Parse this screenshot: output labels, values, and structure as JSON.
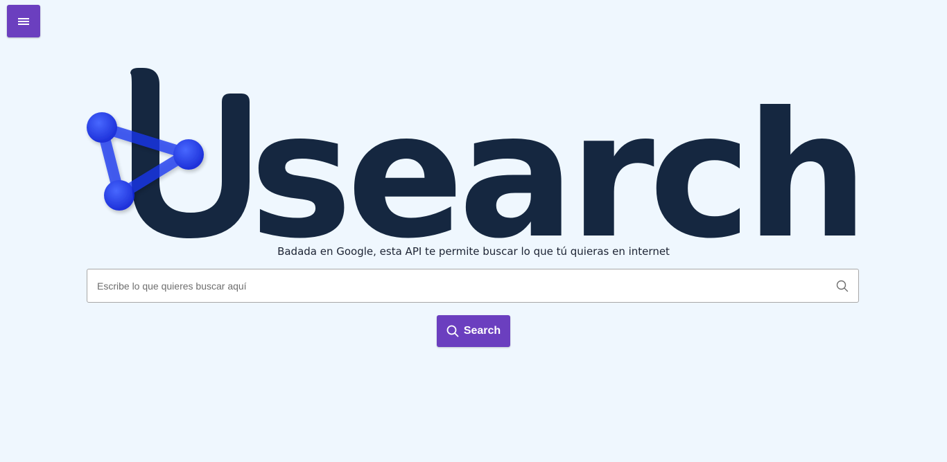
{
  "app": {
    "logo_text": "Usearch",
    "brand_color": "#6b3fbf",
    "logo_text_color": "#152740",
    "logo_mark_color": "#1a3cf0"
  },
  "menu": {
    "icon": "hamburger-menu-icon"
  },
  "hero": {
    "tagline": "Badada en Google, esta API te permite buscar lo que tú quieras en internet"
  },
  "search": {
    "placeholder": "Escribe lo que quieres buscar aquí",
    "value": "",
    "icon": "search-icon",
    "button_label": "Search"
  }
}
